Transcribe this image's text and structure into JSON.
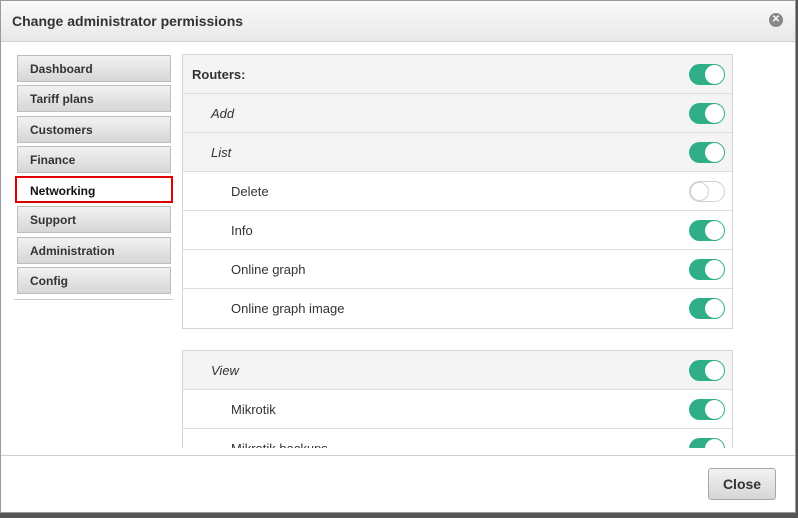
{
  "dialog": {
    "title": "Change administrator permissions",
    "close_icon": "close-icon"
  },
  "sidebar": {
    "items": [
      {
        "label": "Dashboard",
        "active": false
      },
      {
        "label": "Tariff plans",
        "active": false
      },
      {
        "label": "Customers",
        "active": false
      },
      {
        "label": "Finance",
        "active": false
      },
      {
        "label": "Networking",
        "active": true
      },
      {
        "label": "Support",
        "active": false
      },
      {
        "label": "Administration",
        "active": false
      },
      {
        "label": "Config",
        "active": false
      }
    ],
    "highlight_color": "#e00000"
  },
  "permissions": {
    "groups": [
      {
        "rows": [
          {
            "label": "Routers:",
            "level": 0,
            "enabled": true
          },
          {
            "label": "Add",
            "level": 1,
            "enabled": true
          },
          {
            "label": "List",
            "level": 1,
            "enabled": true
          },
          {
            "label": "Delete",
            "level": 2,
            "enabled": false
          },
          {
            "label": "Info",
            "level": 2,
            "enabled": true
          },
          {
            "label": "Online graph",
            "level": 2,
            "enabled": true
          },
          {
            "label": "Online graph image",
            "level": 2,
            "enabled": true
          }
        ]
      },
      {
        "rows": [
          {
            "label": "View",
            "level": 1,
            "enabled": true
          },
          {
            "label": "Mikrotik",
            "level": 2,
            "enabled": true
          },
          {
            "label": "Mikrotik backups",
            "level": 2,
            "enabled": true
          }
        ]
      }
    ],
    "toggle_on_color": "#2fae87"
  },
  "footer": {
    "close_label": "Close"
  }
}
